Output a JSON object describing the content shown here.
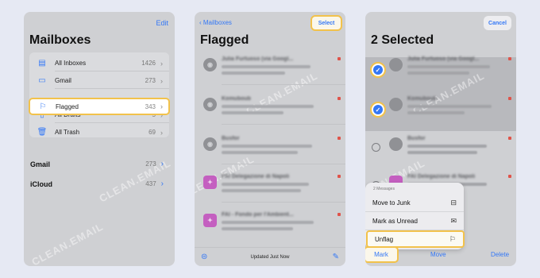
{
  "watermark": "CLEAN.EMAIL",
  "mailboxes_screen": {
    "edit_label": "Edit",
    "title": "Mailboxes",
    "items": [
      {
        "icon": "tray-stack-icon",
        "glyph": "▤",
        "label": "All Inboxes",
        "count": "1426"
      },
      {
        "icon": "tray-icon",
        "glyph": "▭",
        "label": "Gmail",
        "count": "273"
      },
      {
        "icon": "flag-icon",
        "glyph": "⚐",
        "label": "Flagged",
        "count": "343"
      },
      {
        "icon": "document-icon",
        "glyph": "▯",
        "label": "All Drafts",
        "count": "5"
      },
      {
        "icon": "trash-icon",
        "glyph": "🗑",
        "label": "All Trash",
        "count": "69"
      }
    ],
    "accounts": [
      {
        "label": "Gmail",
        "count": "273"
      },
      {
        "label": "iCloud",
        "count": "437"
      }
    ]
  },
  "flagged_screen": {
    "back_label": "Mailboxes",
    "select_label": "Select",
    "title": "Flagged",
    "messages": [
      {
        "sender": "Julia Furtuoso (via Googl...",
        "avatar": "grey"
      },
      {
        "sender": "Komuboub",
        "avatar": "grey"
      },
      {
        "sender": "Busfor",
        "avatar": "grey"
      },
      {
        "sender": "FAI Delegazione di Napoli",
        "avatar": "pink"
      },
      {
        "sender": "FAI - Fondo per l'Ambient...",
        "avatar": "pink"
      }
    ],
    "status": "Updated Just Now"
  },
  "selected_screen": {
    "cancel_label": "Cancel",
    "title": "2 Selected",
    "messages": [
      {
        "sender": "Julia Furtuoso (via Googl...",
        "checked": true
      },
      {
        "sender": "Komuboub",
        "checked": true
      },
      {
        "sender": "Busfor",
        "checked": false
      },
      {
        "sender": "FAI Delegazione di Napoli",
        "checked": false
      }
    ],
    "menu": {
      "header": "2 Messages",
      "items": [
        {
          "label": "Move to Junk",
          "icon": "junk-bin-icon",
          "glyph": "⊟"
        },
        {
          "label": "Mark as Unread",
          "icon": "envelope-badge-icon",
          "glyph": "✉"
        },
        {
          "label": "Unflag",
          "icon": "unflag-icon",
          "glyph": "⚐"
        }
      ]
    },
    "toolbar": {
      "mark": "Mark",
      "move": "Move",
      "delete": "Delete"
    }
  },
  "colors": {
    "accent": "#3478f6",
    "highlight": "#f2c24b",
    "flag": "#e0534a"
  }
}
